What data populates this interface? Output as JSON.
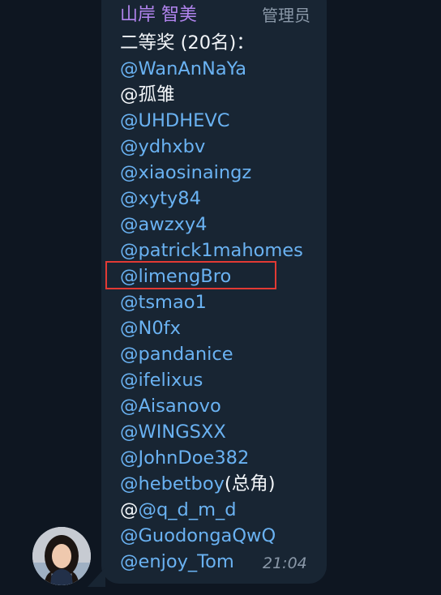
{
  "message": {
    "sender_name": "山岸 智美",
    "sender_role": "管理员",
    "heading": "二等奖 (20名)：",
    "lines": [
      "@WanAnNaYa",
      "@孤雏",
      "@UHDHEVC",
      "@ydhxbv",
      "@xiaosinaingz",
      "@xyty84",
      "@awzxy4",
      "@patrick1mahomes",
      "@limengBro",
      "@tsmao1",
      "@N0fx",
      "@pandanice",
      "@ifelixus",
      "@Aisanovo",
      "@WINGSXX",
      "@JohnDoe382",
      "@hebetboy",
      "@",
      "@GuodongaQwQ",
      "@enjoy_Tom"
    ],
    "suffix_hebetboy": "(总角)",
    "mention_q": "@q_d_m_d",
    "time": "21:04"
  },
  "colors": {
    "background": "#0e1621",
    "bubble": "#182533",
    "sender_name": "#b184ee",
    "mention": "#6ab2f2",
    "plain_text": "#f2f5f8",
    "meta_text": "#8a98a8",
    "highlight_border": "#e23a34"
  }
}
